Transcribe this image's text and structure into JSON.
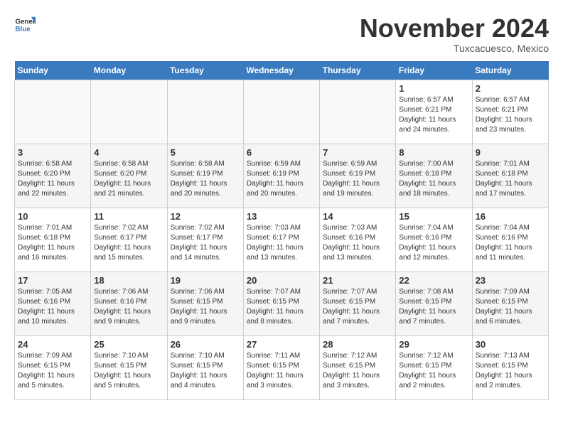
{
  "header": {
    "logo_general": "General",
    "logo_blue": "Blue",
    "month_title": "November 2024",
    "location": "Tuxcacuesco, Mexico"
  },
  "calendar": {
    "days_of_week": [
      "Sunday",
      "Monday",
      "Tuesday",
      "Wednesday",
      "Thursday",
      "Friday",
      "Saturday"
    ],
    "weeks": [
      [
        {
          "day": "",
          "info": ""
        },
        {
          "day": "",
          "info": ""
        },
        {
          "day": "",
          "info": ""
        },
        {
          "day": "",
          "info": ""
        },
        {
          "day": "",
          "info": ""
        },
        {
          "day": "1",
          "info": "Sunrise: 6:57 AM\nSunset: 6:21 PM\nDaylight: 11 hours and 24 minutes."
        },
        {
          "day": "2",
          "info": "Sunrise: 6:57 AM\nSunset: 6:21 PM\nDaylight: 11 hours and 23 minutes."
        }
      ],
      [
        {
          "day": "3",
          "info": "Sunrise: 6:58 AM\nSunset: 6:20 PM\nDaylight: 11 hours and 22 minutes."
        },
        {
          "day": "4",
          "info": "Sunrise: 6:58 AM\nSunset: 6:20 PM\nDaylight: 11 hours and 21 minutes."
        },
        {
          "day": "5",
          "info": "Sunrise: 6:58 AM\nSunset: 6:19 PM\nDaylight: 11 hours and 20 minutes."
        },
        {
          "day": "6",
          "info": "Sunrise: 6:59 AM\nSunset: 6:19 PM\nDaylight: 11 hours and 20 minutes."
        },
        {
          "day": "7",
          "info": "Sunrise: 6:59 AM\nSunset: 6:19 PM\nDaylight: 11 hours and 19 minutes."
        },
        {
          "day": "8",
          "info": "Sunrise: 7:00 AM\nSunset: 6:18 PM\nDaylight: 11 hours and 18 minutes."
        },
        {
          "day": "9",
          "info": "Sunrise: 7:01 AM\nSunset: 6:18 PM\nDaylight: 11 hours and 17 minutes."
        }
      ],
      [
        {
          "day": "10",
          "info": "Sunrise: 7:01 AM\nSunset: 6:18 PM\nDaylight: 11 hours and 16 minutes."
        },
        {
          "day": "11",
          "info": "Sunrise: 7:02 AM\nSunset: 6:17 PM\nDaylight: 11 hours and 15 minutes."
        },
        {
          "day": "12",
          "info": "Sunrise: 7:02 AM\nSunset: 6:17 PM\nDaylight: 11 hours and 14 minutes."
        },
        {
          "day": "13",
          "info": "Sunrise: 7:03 AM\nSunset: 6:17 PM\nDaylight: 11 hours and 13 minutes."
        },
        {
          "day": "14",
          "info": "Sunrise: 7:03 AM\nSunset: 6:16 PM\nDaylight: 11 hours and 13 minutes."
        },
        {
          "day": "15",
          "info": "Sunrise: 7:04 AM\nSunset: 6:16 PM\nDaylight: 11 hours and 12 minutes."
        },
        {
          "day": "16",
          "info": "Sunrise: 7:04 AM\nSunset: 6:16 PM\nDaylight: 11 hours and 11 minutes."
        }
      ],
      [
        {
          "day": "17",
          "info": "Sunrise: 7:05 AM\nSunset: 6:16 PM\nDaylight: 11 hours and 10 minutes."
        },
        {
          "day": "18",
          "info": "Sunrise: 7:06 AM\nSunset: 6:16 PM\nDaylight: 11 hours and 9 minutes."
        },
        {
          "day": "19",
          "info": "Sunrise: 7:06 AM\nSunset: 6:15 PM\nDaylight: 11 hours and 9 minutes."
        },
        {
          "day": "20",
          "info": "Sunrise: 7:07 AM\nSunset: 6:15 PM\nDaylight: 11 hours and 8 minutes."
        },
        {
          "day": "21",
          "info": "Sunrise: 7:07 AM\nSunset: 6:15 PM\nDaylight: 11 hours and 7 minutes."
        },
        {
          "day": "22",
          "info": "Sunrise: 7:08 AM\nSunset: 6:15 PM\nDaylight: 11 hours and 7 minutes."
        },
        {
          "day": "23",
          "info": "Sunrise: 7:09 AM\nSunset: 6:15 PM\nDaylight: 11 hours and 6 minutes."
        }
      ],
      [
        {
          "day": "24",
          "info": "Sunrise: 7:09 AM\nSunset: 6:15 PM\nDaylight: 11 hours and 5 minutes."
        },
        {
          "day": "25",
          "info": "Sunrise: 7:10 AM\nSunset: 6:15 PM\nDaylight: 11 hours and 5 minutes."
        },
        {
          "day": "26",
          "info": "Sunrise: 7:10 AM\nSunset: 6:15 PM\nDaylight: 11 hours and 4 minutes."
        },
        {
          "day": "27",
          "info": "Sunrise: 7:11 AM\nSunset: 6:15 PM\nDaylight: 11 hours and 3 minutes."
        },
        {
          "day": "28",
          "info": "Sunrise: 7:12 AM\nSunset: 6:15 PM\nDaylight: 11 hours and 3 minutes."
        },
        {
          "day": "29",
          "info": "Sunrise: 7:12 AM\nSunset: 6:15 PM\nDaylight: 11 hours and 2 minutes."
        },
        {
          "day": "30",
          "info": "Sunrise: 7:13 AM\nSunset: 6:15 PM\nDaylight: 11 hours and 2 minutes."
        }
      ]
    ]
  }
}
